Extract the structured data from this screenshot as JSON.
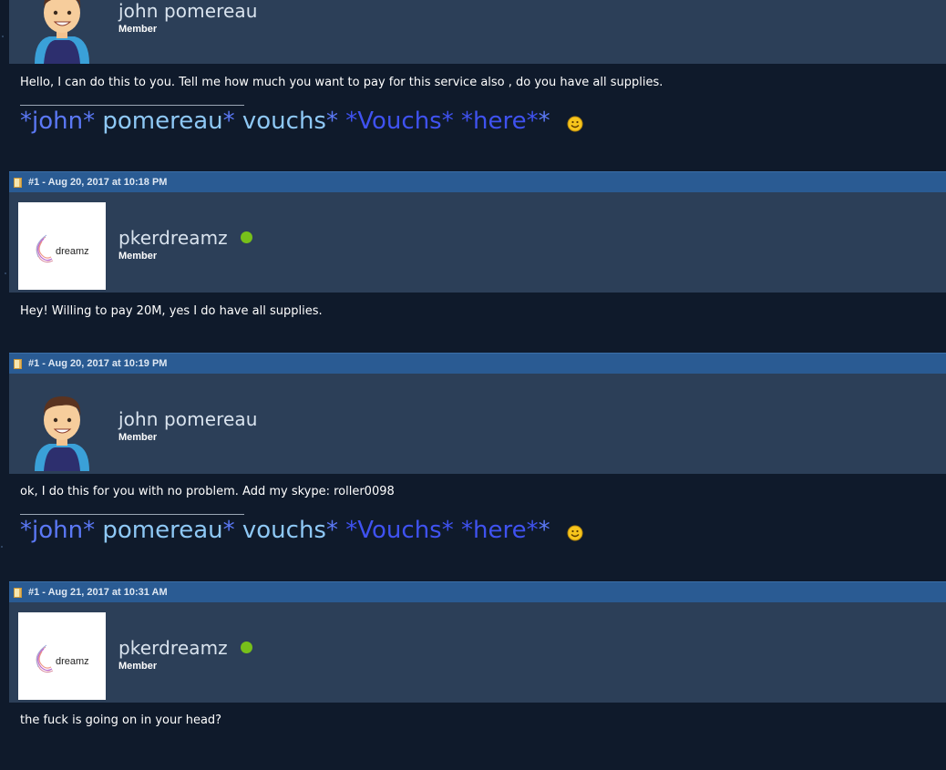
{
  "posts": [
    {
      "header": "",
      "author": "john pomereau",
      "role": "Member",
      "online": false,
      "message": "Hello, I can do this to you. Tell me how much you want to pay for this service also , do you have all supplies.",
      "signature": [
        "*john*",
        " pomereau",
        "*",
        " vouchs",
        "*",
        " *Vouchs*",
        " *here*"
      ]
    },
    {
      "header": "#1 - Aug 20, 2017 at 10:18 PM",
      "author": "pkerdreamz",
      "role": "Member",
      "online": true,
      "avatar_text": "dreamz",
      "message": "Hey! Willing to pay 20M, yes I do have all supplies."
    },
    {
      "header": "#1 - Aug 20, 2017 at 10:19 PM",
      "author": "john pomereau",
      "role": "Member",
      "online": false,
      "message": "ok, I do this for you with no problem. Add my skype: roller0098",
      "signature": [
        "*john*",
        " pomereau",
        "*",
        " vouchs",
        "*",
        " *Vouchs*",
        " *here*"
      ]
    },
    {
      "header": "#1 - Aug 21, 2017 at 10:31 AM",
      "author": "pkerdreamz",
      "role": "Member",
      "online": true,
      "avatar_text": "dreamz",
      "message": "the fuck is going on in your head?"
    }
  ],
  "colors": {
    "page_bg": "#0f1a2b",
    "user_panel": "#2c3f58",
    "post_bar": "#2a5b93",
    "online": "#77c01a",
    "sig_blue": "#5b78f5",
    "sig_light": "#8ec8f5",
    "sig_deep": "#3f52f0"
  },
  "icons": [
    "post-document-icon",
    "smiley-icon",
    "online-status-icon"
  ]
}
